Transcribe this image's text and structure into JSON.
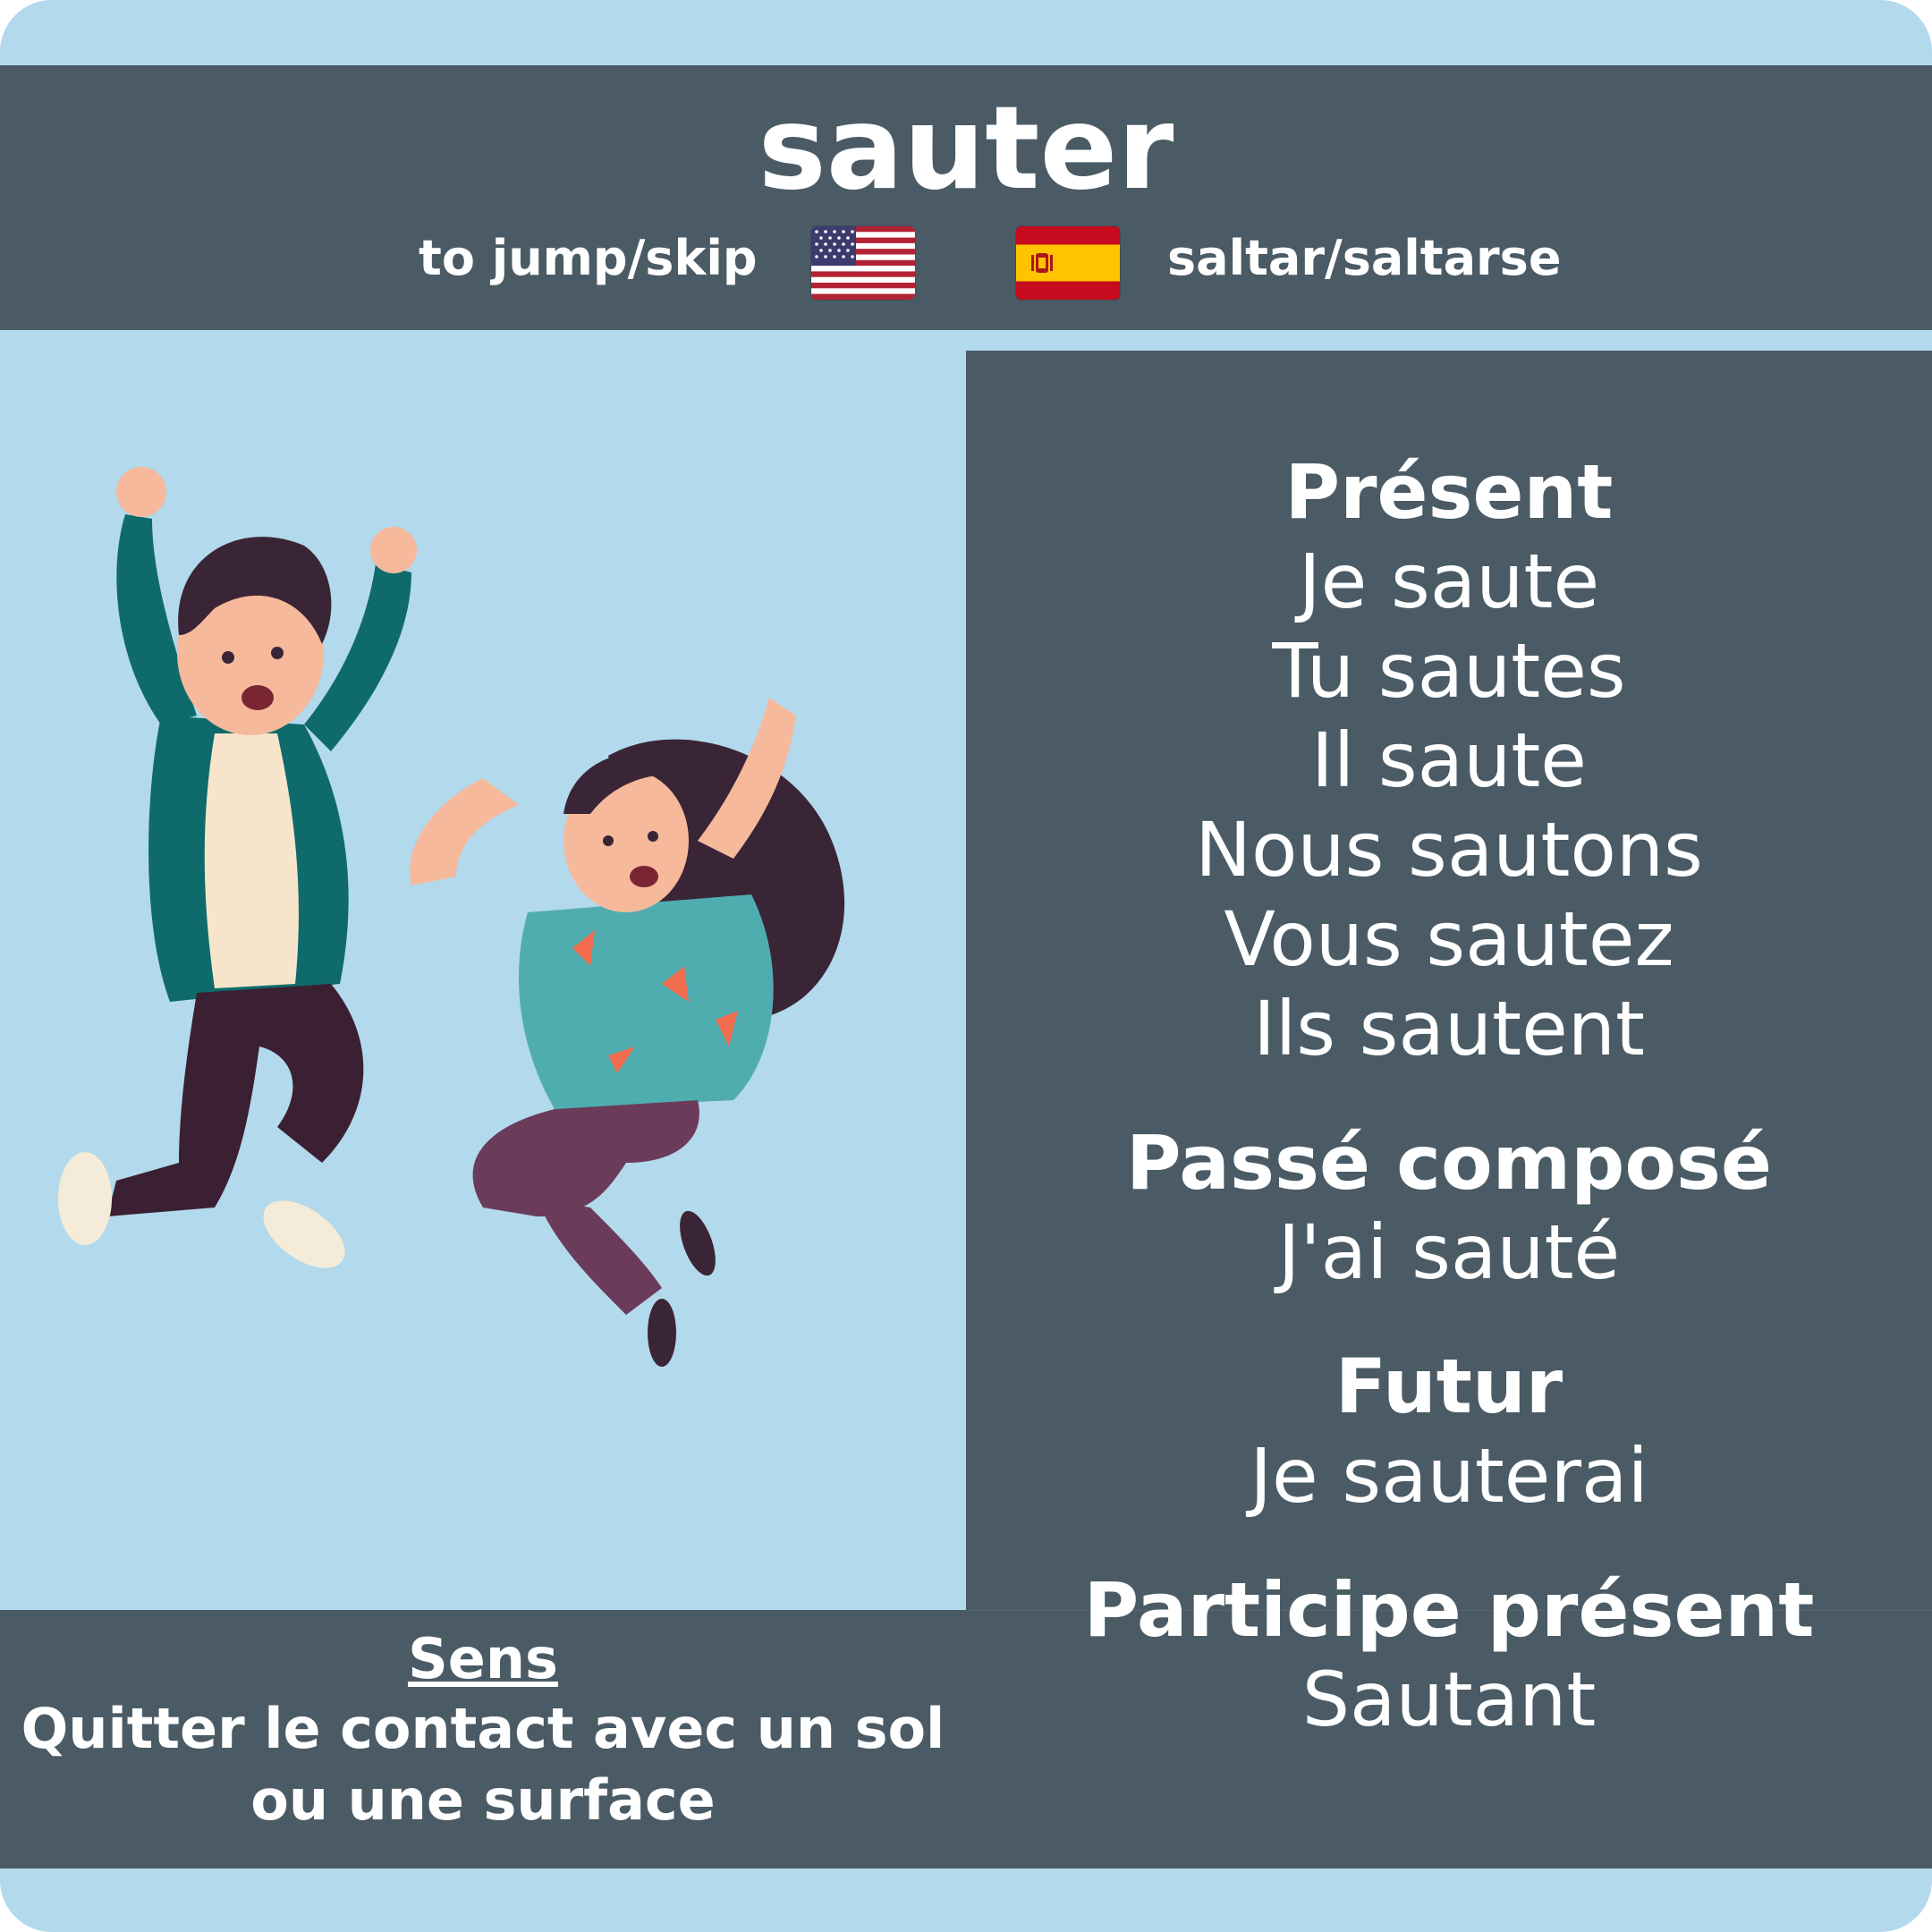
{
  "verb": "sauter",
  "translations": {
    "english": "to jump/skip",
    "spanish": "saltar/saltarse"
  },
  "icons": {
    "english_flag": "us-flag-icon",
    "spanish_flag": "spain-flag-icon",
    "illustration": "two-people-jumping-illustration"
  },
  "meaning": {
    "heading": "Sens",
    "text": "Quitter le contact avec un sol ou une surface"
  },
  "tenses": {
    "present": {
      "title": "Présent",
      "forms": [
        "Je saute",
        "Tu sautes",
        "Il saute",
        "Nous sautons",
        "Vous sautez",
        "Ils sautent"
      ]
    },
    "passe_compose": {
      "title": "Passé composé",
      "forms": [
        "J'ai sauté"
      ]
    },
    "futur": {
      "title": "Futur",
      "forms": [
        "Je sauterai"
      ]
    },
    "participe_present": {
      "title": "Participe présent",
      "forms": [
        "Sautant"
      ]
    }
  },
  "colors": {
    "background": "#b3d9ec",
    "panel": "#4a5b66",
    "text": "#ffffff"
  }
}
